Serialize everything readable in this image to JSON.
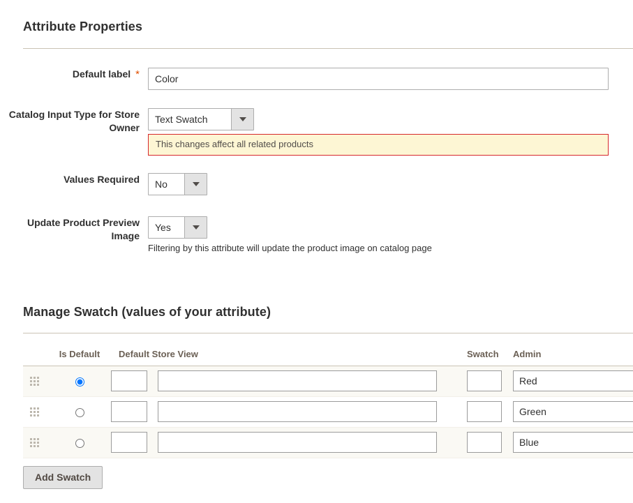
{
  "attribute_properties": {
    "heading": "Attribute Properties",
    "fields": {
      "default_label": {
        "label": "Default label",
        "required_marker": "*",
        "value": "Color"
      },
      "catalog_input_type": {
        "label": "Catalog Input Type for Store Owner",
        "value": "Text Swatch",
        "warning": "This changes affect all related products"
      },
      "values_required": {
        "label": "Values Required",
        "value": "No"
      },
      "update_preview_image": {
        "label": "Update Product Preview Image",
        "value": "Yes",
        "hint": "Filtering by this attribute will update the product image on catalog page"
      }
    }
  },
  "manage_swatch": {
    "heading": "Manage Swatch (values of your attribute)",
    "columns": {
      "drag": "",
      "is_default": "Is Default",
      "default_store_view": "Default Store View",
      "swatch": "Swatch",
      "admin": "Admin"
    },
    "rows": [
      {
        "is_default": true,
        "store_view_color": "",
        "store_view_label": "",
        "swatch_color": "",
        "admin": "Red"
      },
      {
        "is_default": false,
        "store_view_color": "",
        "store_view_label": "",
        "swatch_color": "",
        "admin": "Green"
      },
      {
        "is_default": false,
        "store_view_color": "",
        "store_view_label": "",
        "swatch_color": "",
        "admin": "Blue"
      }
    ],
    "add_button_label": "Add Swatch"
  },
  "colors": {
    "heading_text": "#303030",
    "label_text": "#303030",
    "required_star": "#e04f00",
    "rule": "#cac3b4",
    "warning_border": "#d6282b",
    "warning_bg": "#fdf6d4",
    "table_header_text": "#6b6055",
    "alt_row_bg": "#faf9f4",
    "button_bg": "#e3e3e3",
    "input_border": "#adadad"
  }
}
